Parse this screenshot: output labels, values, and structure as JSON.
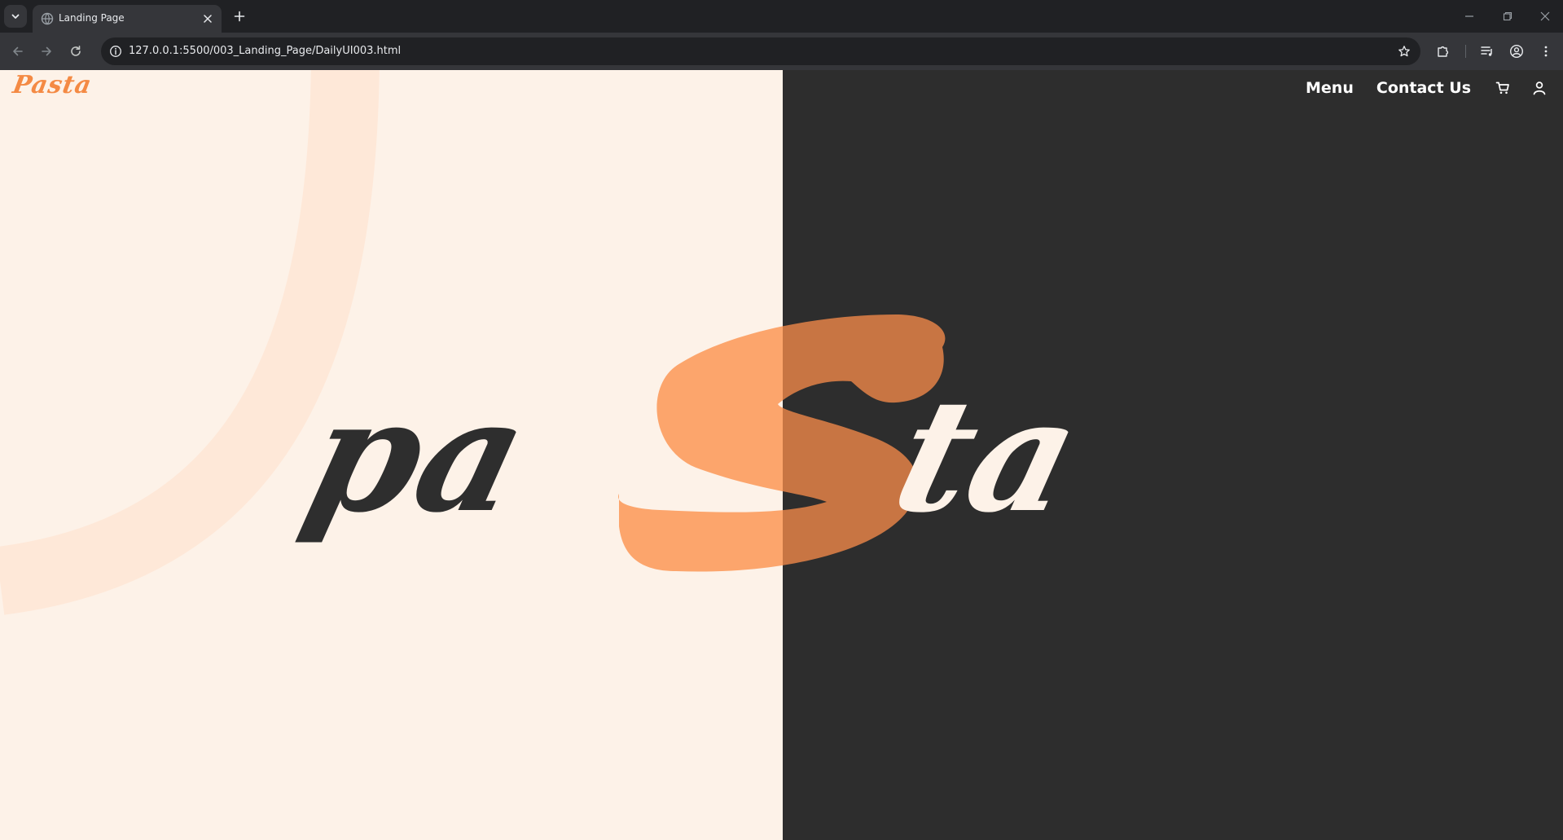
{
  "browser": {
    "tab_title": "Landing Page",
    "url": "127.0.0.1:5500/003_Landing_Page/DailyUI003.html"
  },
  "page": {
    "logo": "Pasta",
    "nav": {
      "menu": "Menu",
      "contact": "Contact Us"
    },
    "hero_word": {
      "part1": "pa",
      "part2": "S",
      "part3": "ta"
    },
    "icons": [
      "tab-search-icon",
      "globe-icon",
      "close-icon",
      "plus-icon",
      "back-icon",
      "forward-icon",
      "reload-icon",
      "info-icon",
      "star-icon",
      "extensions-icon",
      "media-icon",
      "profile-icon",
      "more-icon",
      "cart-icon",
      "user-icon"
    ]
  },
  "colors": {
    "cream_background": "#fdf2e8",
    "dark_background": "#2d2d2d",
    "accent_orange": "#f48a44",
    "s_light": "#fca56c",
    "s_dark": "#c87543",
    "text_dark": "#2e2e2e",
    "text_light": "#fdf2e8"
  }
}
